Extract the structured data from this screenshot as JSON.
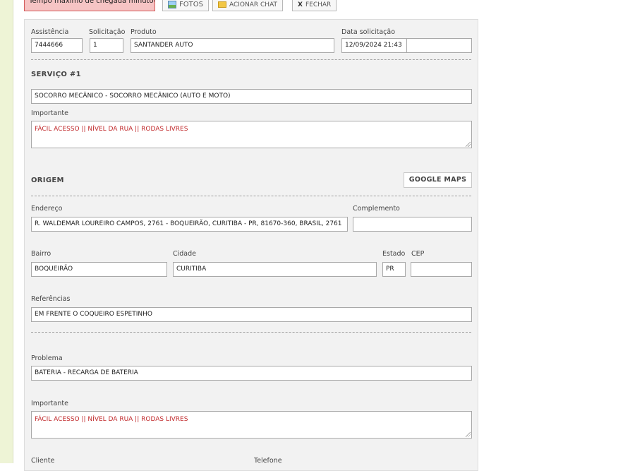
{
  "toolbar": {
    "timer_text": "Tempo máximo de chegada minuto(s)",
    "photos_label": "FOTOS",
    "chat_label": "ACIONAR CHAT",
    "close_label": "FECHAR",
    "close_glyph": "X"
  },
  "header": {
    "assistencia_label": "Assistência",
    "assistencia_value": "7444666",
    "solicitacao_label": "Solicitação",
    "solicitacao_value": "1",
    "produto_label": "Produto",
    "produto_value": "SANTANDER AUTO",
    "data_label": "Data solicitação",
    "data_value": "12/09/2024 21:43",
    "extra_value": ""
  },
  "servico": {
    "title": "SERVIÇO #1",
    "service_value": "SOCORRO MECÂNICO - SOCORRO MECÂNICO (AUTO E MOTO)",
    "importante_label": "Importante",
    "importante_value": "FÁCIL ACESSO || NÍVEL DA RUA || RODAS LIVRES"
  },
  "origem": {
    "title": "ORIGEM",
    "google_maps_label": "GOOGLE MAPS",
    "endereco_label": "Endereço",
    "endereco_value": "R. WALDEMAR LOUREIRO CAMPOS, 2761 - BOQUEIRÃO, CURITIBA - PR, 81670-360, BRASIL, 2761",
    "complemento_label": "Complemento",
    "complemento_value": "",
    "bairro_label": "Bairro",
    "bairro_value": "BOQUEIRÃO",
    "cidade_label": "Cidade",
    "cidade_value": "CURITIBA",
    "estado_label": "Estado",
    "estado_value": "PR",
    "cep_label": "CEP",
    "cep_value": "",
    "referencias_label": "Referências",
    "referencias_value": "EM FRENTE O COQUEIRO ESPETINHO"
  },
  "problema": {
    "label": "Problema",
    "value": "BATERIA - RECARGA DE BATERIA",
    "importante_label": "Importante",
    "importante_value": "FÁCIL ACESSO || NÍVEL DA RUA || RODAS LIVRES"
  },
  "cliente": {
    "cliente_label": "Cliente",
    "telefone_label": "Telefone"
  },
  "colors": {
    "important_text": "#c0282a",
    "timer_bg": "#f6c4c4",
    "side_strip": "#eef4d6"
  }
}
